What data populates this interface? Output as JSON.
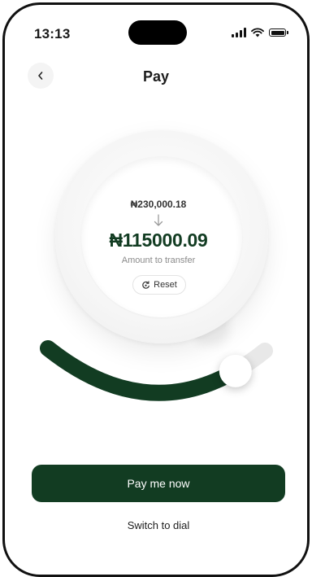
{
  "status_bar": {
    "time": "13:13",
    "icons": [
      "signal-icon",
      "wifi-icon",
      "battery-icon"
    ]
  },
  "header": {
    "title": "Pay",
    "back_icon": "chevron-left-icon"
  },
  "dial": {
    "balance": "₦230,000.18",
    "arrow_icon": "arrow-down-icon",
    "amount": "₦115000.09",
    "caption": "Amount to transfer",
    "reset_label": "Reset",
    "reset_icon": "reset-icon"
  },
  "slider": {
    "value_fraction": 0.85,
    "track_color": "#e8e8e8",
    "fill_color": "#123c22"
  },
  "actions": {
    "pay_label": "Pay me now",
    "switch_label": "Switch to dial"
  },
  "colors": {
    "brand": "#123c22"
  }
}
